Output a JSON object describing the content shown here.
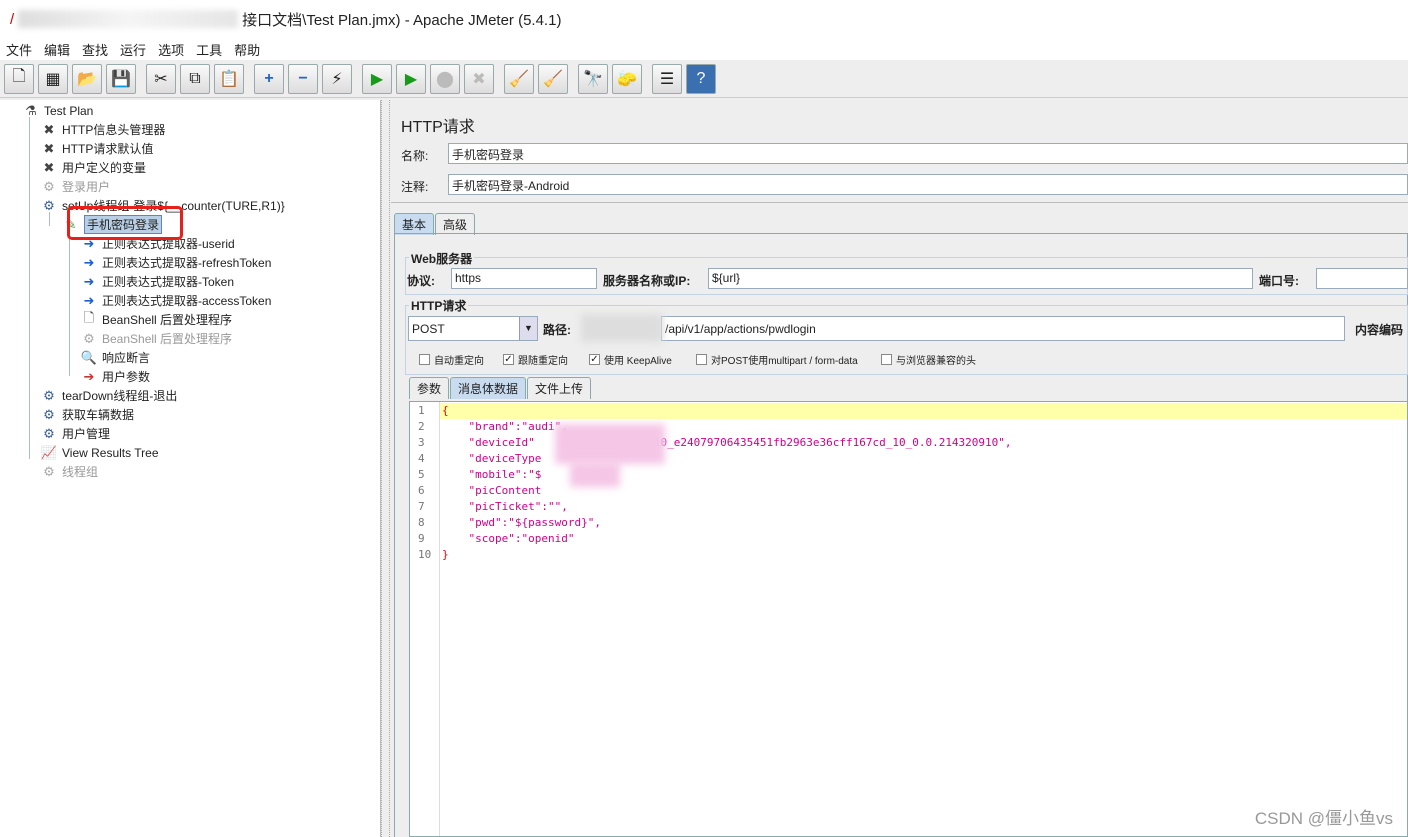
{
  "window": {
    "title": "接口文档\\Test Plan.jmx) - Apache JMeter (5.4.1)"
  },
  "menu": [
    "文件",
    "编辑",
    "查找",
    "运行",
    "选项",
    "工具",
    "帮助"
  ],
  "toolbar": [
    {
      "icon": "new-icon",
      "glyph": "🗋"
    },
    {
      "icon": "templates-icon",
      "glyph": "▦"
    },
    {
      "icon": "open-icon",
      "glyph": "📂"
    },
    {
      "icon": "save-icon",
      "glyph": "💾"
    },
    {
      "icon": "cut-icon",
      "glyph": "✂"
    },
    {
      "icon": "copy-icon",
      "glyph": "⧉"
    },
    {
      "icon": "paste-icon",
      "glyph": "📋"
    },
    {
      "icon": "expand-icon",
      "glyph": "+"
    },
    {
      "icon": "collapse-icon",
      "glyph": "−"
    },
    {
      "icon": "toggle-icon",
      "glyph": "⚡"
    },
    {
      "icon": "start-icon",
      "glyph": "▶"
    },
    {
      "icon": "start-no-pause-icon",
      "glyph": "▶"
    },
    {
      "icon": "stop-icon",
      "glyph": "⬤"
    },
    {
      "icon": "shutdown-icon",
      "glyph": "✖"
    },
    {
      "icon": "clear-icon",
      "glyph": "🧹"
    },
    {
      "icon": "clear-all-icon",
      "glyph": "🧹"
    },
    {
      "icon": "search-icon",
      "glyph": "🔭"
    },
    {
      "icon": "reset-search-icon",
      "glyph": "🧽"
    },
    {
      "icon": "function-helper-icon",
      "glyph": "☰"
    },
    {
      "icon": "help-icon",
      "glyph": "?"
    }
  ],
  "tree": [
    {
      "label": "Test Plan",
      "icon": "flask-icon",
      "glyph": "⚗",
      "level": 0,
      "disabled": false
    },
    {
      "label": "HTTP信息头管理器",
      "icon": "tools-icon",
      "glyph": "✖",
      "level": 1,
      "disabled": false
    },
    {
      "label": "HTTP请求默认值",
      "icon": "tools-icon",
      "glyph": "✖",
      "level": 1,
      "disabled": false
    },
    {
      "label": "用户定义的变量",
      "icon": "tools-icon",
      "glyph": "✖",
      "level": 1,
      "disabled": false
    },
    {
      "label": "登录用户",
      "icon": "gear-icon",
      "glyph": "⚙",
      "level": 1,
      "disabled": true
    },
    {
      "label": "setUp线程组-登录${__counter(TURE,R1)}",
      "icon": "gear-icon",
      "glyph": "⚙",
      "level": 1,
      "disabled": false
    },
    {
      "label": "手机密码登录",
      "icon": "pipette-icon",
      "glyph": "✎",
      "level": 2,
      "disabled": false,
      "selected": true
    },
    {
      "label": "正则表达式提取器-userid",
      "icon": "extractor-icon",
      "glyph": "➜",
      "level": 3,
      "disabled": false
    },
    {
      "label": "正则表达式提取器-refreshToken",
      "icon": "extractor-icon",
      "glyph": "➜",
      "level": 3,
      "disabled": false
    },
    {
      "label": "正则表达式提取器-Token",
      "icon": "extractor-icon",
      "glyph": "➜",
      "level": 3,
      "disabled": false
    },
    {
      "label": "正则表达式提取器-accessToken",
      "icon": "extractor-icon",
      "glyph": "➜",
      "level": 3,
      "disabled": false
    },
    {
      "label": "BeanShell 后置处理程序",
      "icon": "document-icon",
      "glyph": "🗋",
      "level": 3,
      "disabled": false
    },
    {
      "label": "BeanShell 后置处理程序",
      "icon": "gear-icon",
      "glyph": "⚙",
      "level": 3,
      "disabled": true
    },
    {
      "label": "响应断言",
      "icon": "magnifier-icon",
      "glyph": "🔍",
      "level": 3,
      "disabled": false
    },
    {
      "label": "用户参数",
      "icon": "arrow-icon",
      "glyph": "➔",
      "level": 3,
      "disabled": false
    },
    {
      "label": "tearDown线程组-退出",
      "icon": "gear-icon",
      "glyph": "⚙",
      "level": 1,
      "disabled": false
    },
    {
      "label": "获取车辆数据",
      "icon": "gear-icon",
      "glyph": "⚙",
      "level": 1,
      "disabled": false
    },
    {
      "label": "用户管理",
      "icon": "gear-icon",
      "glyph": "⚙",
      "level": 1,
      "disabled": false
    },
    {
      "label": "View Results Tree",
      "icon": "graph-icon",
      "glyph": "📈",
      "level": 1,
      "disabled": false
    },
    {
      "label": "线程组",
      "icon": "gear-icon",
      "glyph": "⚙",
      "level": 1,
      "disabled": true
    }
  ],
  "panel": {
    "title": "HTTP请求",
    "name_label": "名称:",
    "name_value": "手机密码登录",
    "comment_label": "注释:",
    "comment_value": "手机密码登录-Android",
    "tabs": [
      "基本",
      "高级"
    ],
    "web_server": {
      "title": "Web服务器",
      "protocol_label": "协议:",
      "protocol": "https",
      "server_label": "服务器名称或IP:",
      "server": "${url}",
      "port_label": "端口号:",
      "port": ""
    },
    "http_request": {
      "title": "HTTP请求",
      "method": "POST",
      "path_label": "路径:",
      "path": "/api/v1/app/actions/pwdlogin",
      "encoding_label": "内容编码"
    },
    "checkboxes": [
      {
        "label": "自动重定向",
        "checked": false
      },
      {
        "label": "跟随重定向",
        "checked": true
      },
      {
        "label": "使用 KeepAlive",
        "checked": true
      },
      {
        "label": "对POST使用multipart / form-data",
        "checked": false
      },
      {
        "label": "与浏览器兼容的头",
        "checked": false
      }
    ],
    "subtabs": [
      "参数",
      "消息体数据",
      "文件上传"
    ],
    "active_subtab": 1,
    "body_lines": [
      "{",
      "    \"brand\":\"audi\",",
      "    \"deviceId\"                AL10_e24079706435451fb2963e36cff167cd_10_0.0.214320910\",",
      "    \"deviceType",
      "    \"mobile\":\"$        \",",
      "    \"picContent",
      "    \"picTicket\":\"\",",
      "    \"pwd\":\"${password}\",",
      "    \"scope\":\"openid\"",
      "}"
    ]
  },
  "watermark": "CSDN @僵小鱼vs"
}
